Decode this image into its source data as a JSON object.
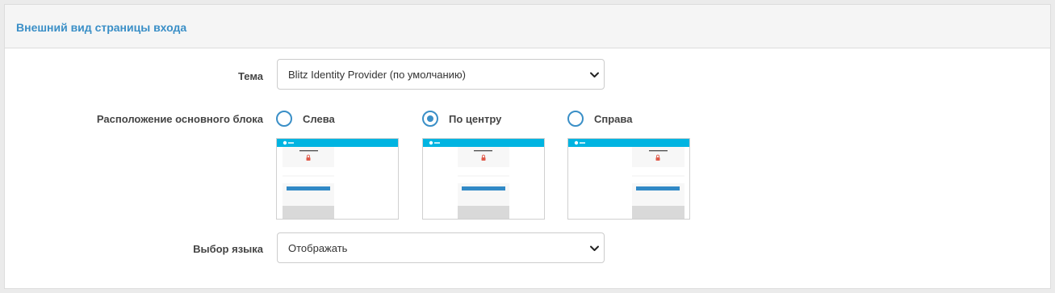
{
  "panel": {
    "title": "Внешний вид страницы входа"
  },
  "theme": {
    "label": "Тема",
    "value": "Blitz Identity Provider (по умолчанию)"
  },
  "layout": {
    "label": "Расположение основного блока",
    "options": [
      {
        "label": "Слева",
        "checked": false
      },
      {
        "label": "По центру",
        "checked": true
      },
      {
        "label": "Справа",
        "checked": false
      }
    ]
  },
  "language": {
    "label": "Выбор языка",
    "value": "Отображать"
  },
  "colors": {
    "accent": "#3a8fc7",
    "preview_header": "#00b4e1",
    "preview_button": "#3189c6",
    "lock_icon": "#e05a4a"
  }
}
